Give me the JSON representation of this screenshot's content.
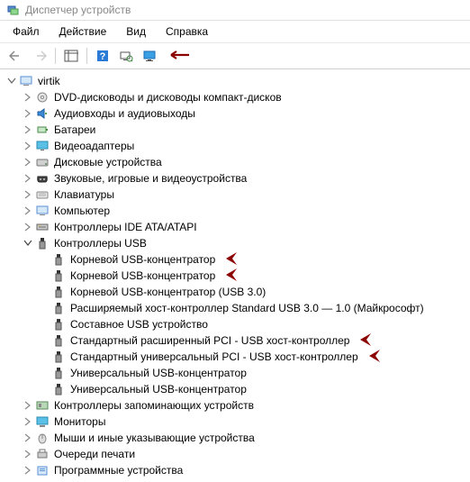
{
  "window": {
    "title": "Диспетчер устройств"
  },
  "menu": {
    "file": "Файл",
    "action": "Действие",
    "view": "Вид",
    "help": "Справка"
  },
  "tree": {
    "root": "virtik",
    "items": [
      {
        "icon": "disc",
        "label": "DVD-дисководы и дисководы компакт-дисков"
      },
      {
        "icon": "audio",
        "label": "Аудиовходы и аудиовыходы"
      },
      {
        "icon": "battery",
        "label": "Батареи"
      },
      {
        "icon": "display",
        "label": "Видеоадаптеры"
      },
      {
        "icon": "disk",
        "label": "Дисковые устройства"
      },
      {
        "icon": "game",
        "label": "Звуковые, игровые и видеоустройства"
      },
      {
        "icon": "keyboard",
        "label": "Клавиатуры"
      },
      {
        "icon": "computer",
        "label": "Компьютер"
      },
      {
        "icon": "ide",
        "label": "Контроллеры IDE ATA/ATAPI"
      },
      {
        "icon": "usb",
        "label": "Контроллеры USB",
        "expanded": true,
        "children": [
          {
            "label": "Корневой USB-концентратор",
            "annot": true
          },
          {
            "label": "Корневой USB-концентратор",
            "annot": true
          },
          {
            "label": "Корневой USB-концентратор (USB 3.0)"
          },
          {
            "label": "Расширяемый хост-контроллер Standard USB 3.0 — 1.0 (Майкрософт)"
          },
          {
            "label": "Составное USB устройство"
          },
          {
            "label": "Стандартный расширенный PCI - USB хост-контроллер",
            "annot": true
          },
          {
            "label": "Стандартный универсальный PCI - USB хост-контроллер",
            "annot": true
          },
          {
            "label": "Универсальный USB-концентратор"
          },
          {
            "label": "Универсальный USB-концентратор"
          }
        ]
      },
      {
        "icon": "storage",
        "label": "Контроллеры запоминающих устройств"
      },
      {
        "icon": "monitor",
        "label": "Мониторы"
      },
      {
        "icon": "mouse",
        "label": "Мыши и иные указывающие устройства"
      },
      {
        "icon": "printq",
        "label": "Очереди печати"
      },
      {
        "icon": "program",
        "label": "Программные устройства"
      }
    ]
  }
}
